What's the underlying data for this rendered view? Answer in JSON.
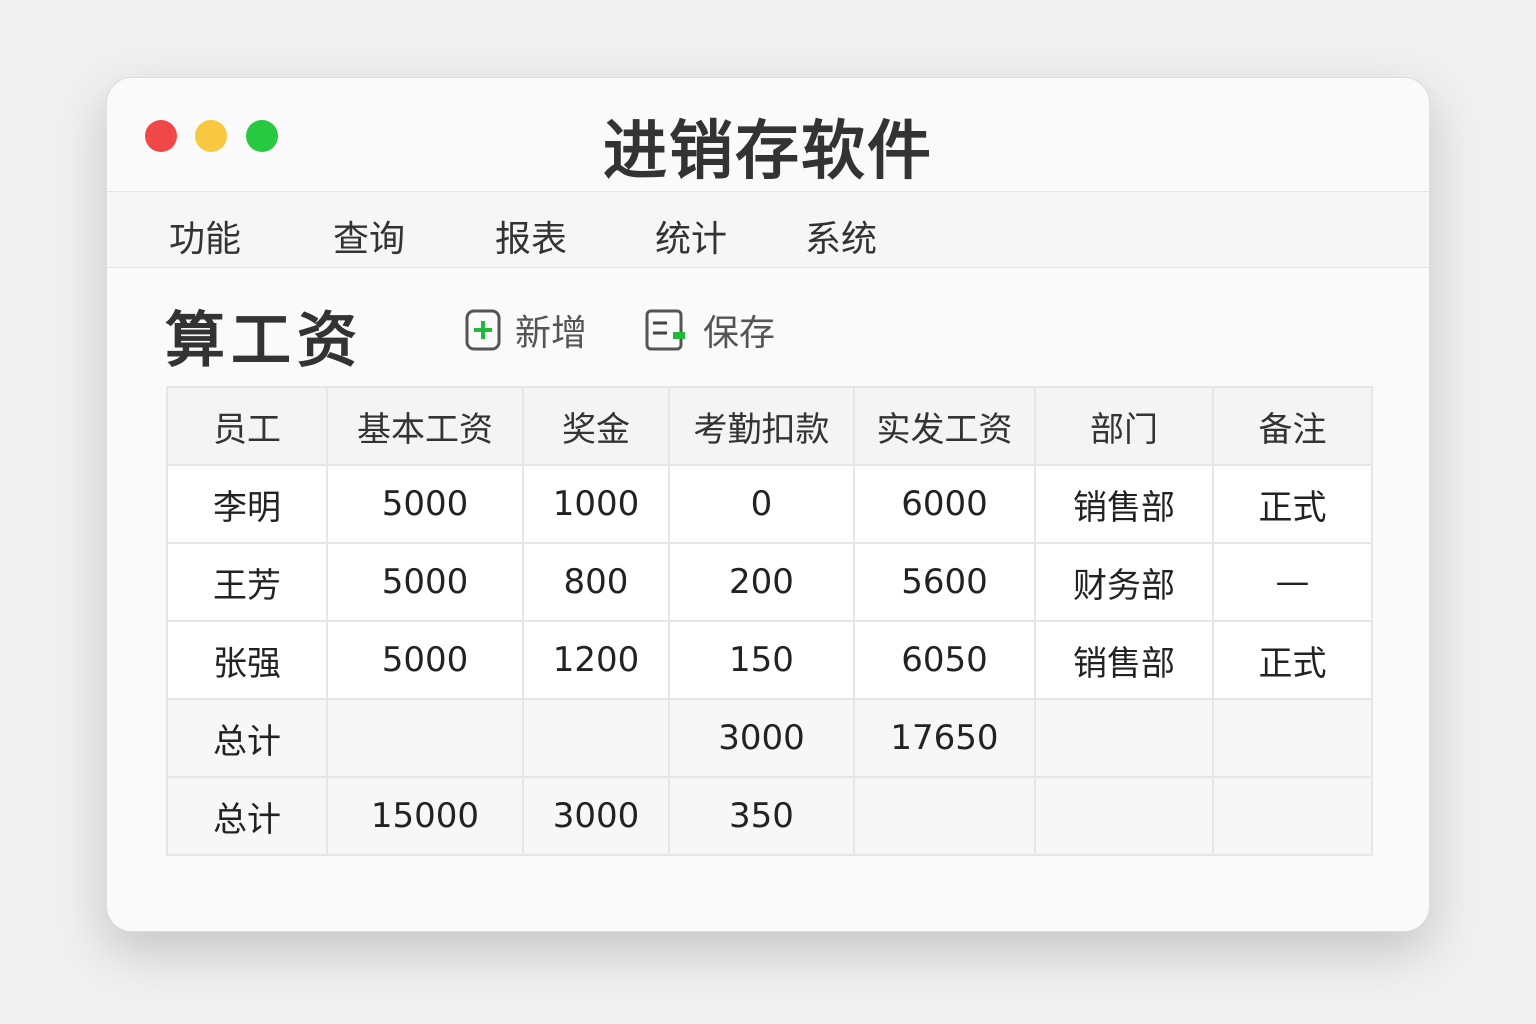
{
  "window": {
    "title": "进销存软件",
    "colors": {
      "close": "#f04848",
      "minimize": "#f8c840",
      "maximize": "#28c840",
      "accent": "#22b83a"
    }
  },
  "menu": [
    "功能",
    "查询",
    "报表",
    "统计",
    "系统"
  ],
  "page": {
    "heading": "算工资",
    "toolbar": {
      "add": "新增",
      "save": "保存"
    }
  },
  "table": {
    "headers": [
      "员工",
      "基本工资",
      "奖金",
      "考勤扣款",
      "实发工资",
      "部门",
      "备注"
    ],
    "rows": [
      [
        "李明",
        "5000",
        "1000",
        "0",
        "6000",
        "销售部",
        "正式"
      ],
      [
        "王芳",
        "5000",
        "800",
        "200",
        "5600",
        "财务部",
        "—"
      ],
      [
        "张强",
        "5000",
        "1200",
        "150",
        "6050",
        "销售部",
        "正式"
      ],
      [
        "总计",
        "",
        "",
        "3000",
        "17650",
        "",
        ""
      ],
      [
        "总计",
        "15000",
        "3000",
        "350",
        "",
        "",
        ""
      ]
    ]
  }
}
